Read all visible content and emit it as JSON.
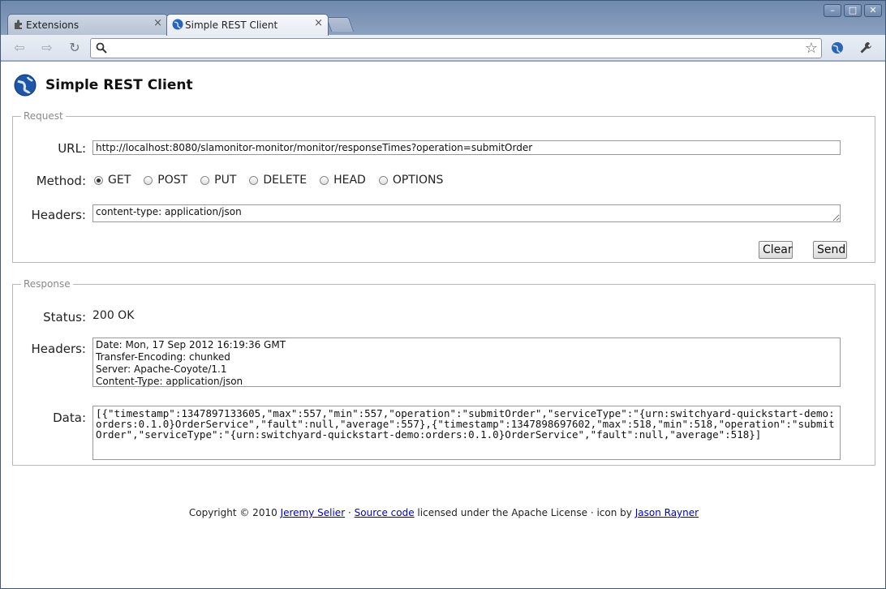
{
  "browser": {
    "tabs": [
      {
        "label": "Extensions",
        "icon": "puzzle-icon"
      },
      {
        "label": "Simple REST Client",
        "icon": "globe-icon"
      }
    ],
    "tab_close_glyph": "×",
    "omnibox_value": "",
    "window_controls": {
      "minimize": "–",
      "maximize": "□",
      "close": "✕"
    }
  },
  "app": {
    "title": "Simple REST Client",
    "request": {
      "legend": "Request",
      "url_label": "URL:",
      "url_value": "http://localhost:8080/slamonitor-monitor/monitor/responseTimes?operation=submitOrder",
      "method_label": "Method:",
      "methods": [
        "GET",
        "POST",
        "PUT",
        "DELETE",
        "HEAD",
        "OPTIONS"
      ],
      "selected_method": "GET",
      "headers_label": "Headers:",
      "headers_value": "content-type: application/json",
      "clear_label": "Clear",
      "send_label": "Send"
    },
    "response": {
      "legend": "Response",
      "status_label": "Status:",
      "status_value": "200 OK",
      "headers_label": "Headers:",
      "headers_lines": [
        "Date: Mon, 17 Sep 2012 16:19:36 GMT",
        "Transfer-Encoding: chunked",
        "Server: Apache-Coyote/1.1",
        "Content-Type: application/json"
      ],
      "data_label": "Data:",
      "data_value": "[{\"timestamp\":1347897133605,\"max\":557,\"min\":557,\"operation\":\"submitOrder\",\"serviceType\":\"{urn:switchyard-quickstart-demo:orders:0.1.0}OrderService\",\"fault\":null,\"average\":557},{\"timestamp\":1347898697602,\"max\":518,\"min\":518,\"operation\":\"submitOrder\",\"serviceType\":\"{urn:switchyard-quickstart-demo:orders:0.1.0}OrderService\",\"fault\":null,\"average\":518}]"
    },
    "footer": {
      "copyright": "Copyright © 2010",
      "author_link": "Jeremy Selier",
      "sep": "·",
      "source_link": "Source code",
      "license_text": "licensed under the Apache License · icon by",
      "icon_link": "Jason Rayner"
    }
  }
}
